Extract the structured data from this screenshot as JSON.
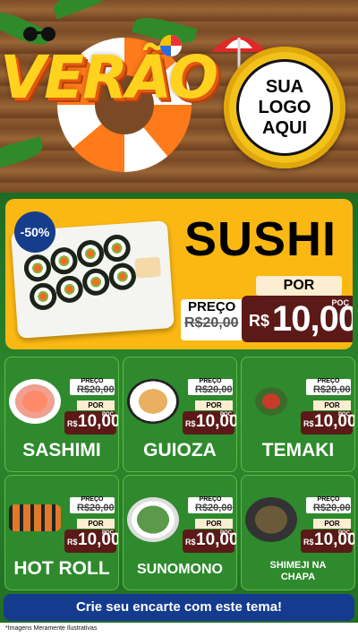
{
  "header": {
    "theme_title": "VERÃO",
    "logo_lines": [
      "SUA",
      "LOGO",
      "AQUI"
    ]
  },
  "hero": {
    "discount": "-50%",
    "title": "SUSHI",
    "preco_label": "PREÇO",
    "old_price": "R$20,00",
    "por_label": "POR",
    "currency": "R$",
    "price": "10,00",
    "price_suffix": "POÇ"
  },
  "cards": [
    {
      "name": "SASHIMI",
      "preco_label": "PREÇO",
      "old_price": "R$20,00",
      "por_label": "POR",
      "currency": "R$",
      "price": "10,00",
      "suffix": "POÇ"
    },
    {
      "name": "GUIOZA",
      "preco_label": "PREÇO",
      "old_price": "R$20,00",
      "por_label": "POR",
      "currency": "R$",
      "price": "10,00",
      "suffix": "POÇ"
    },
    {
      "name": "TEMAKI",
      "preco_label": "PREÇO",
      "old_price": "R$20,00",
      "por_label": "POR",
      "currency": "R$",
      "price": "10,00",
      "suffix": "POÇ"
    },
    {
      "name": "HOT ROLL",
      "preco_label": "PREÇO",
      "old_price": "R$20,00",
      "por_label": "POR",
      "currency": "R$",
      "price": "10,00",
      "suffix": "POÇ"
    },
    {
      "name": "SUNOMONO",
      "preco_label": "PREÇO",
      "old_price": "R$20,00",
      "por_label": "POR",
      "currency": "R$",
      "price": "10,00",
      "suffix": "POÇ"
    },
    {
      "name_lines": [
        "SHIMEJI NA",
        "CHAPA"
      ],
      "preco_label": "PREÇO",
      "old_price": "R$20,00",
      "por_label": "POR",
      "currency": "R$",
      "price": "10,00",
      "suffix": "POÇ"
    }
  ],
  "cta": {
    "label": "Crie seu encarte com este tema!"
  },
  "footer": {
    "note": "*Imagens Meramente Ilustrativas"
  },
  "colors": {
    "accent": "#fbb813",
    "price_bg": "#5b1a17",
    "card_bg": "#2e8a2c",
    "cta_bg": "#153b8f"
  }
}
